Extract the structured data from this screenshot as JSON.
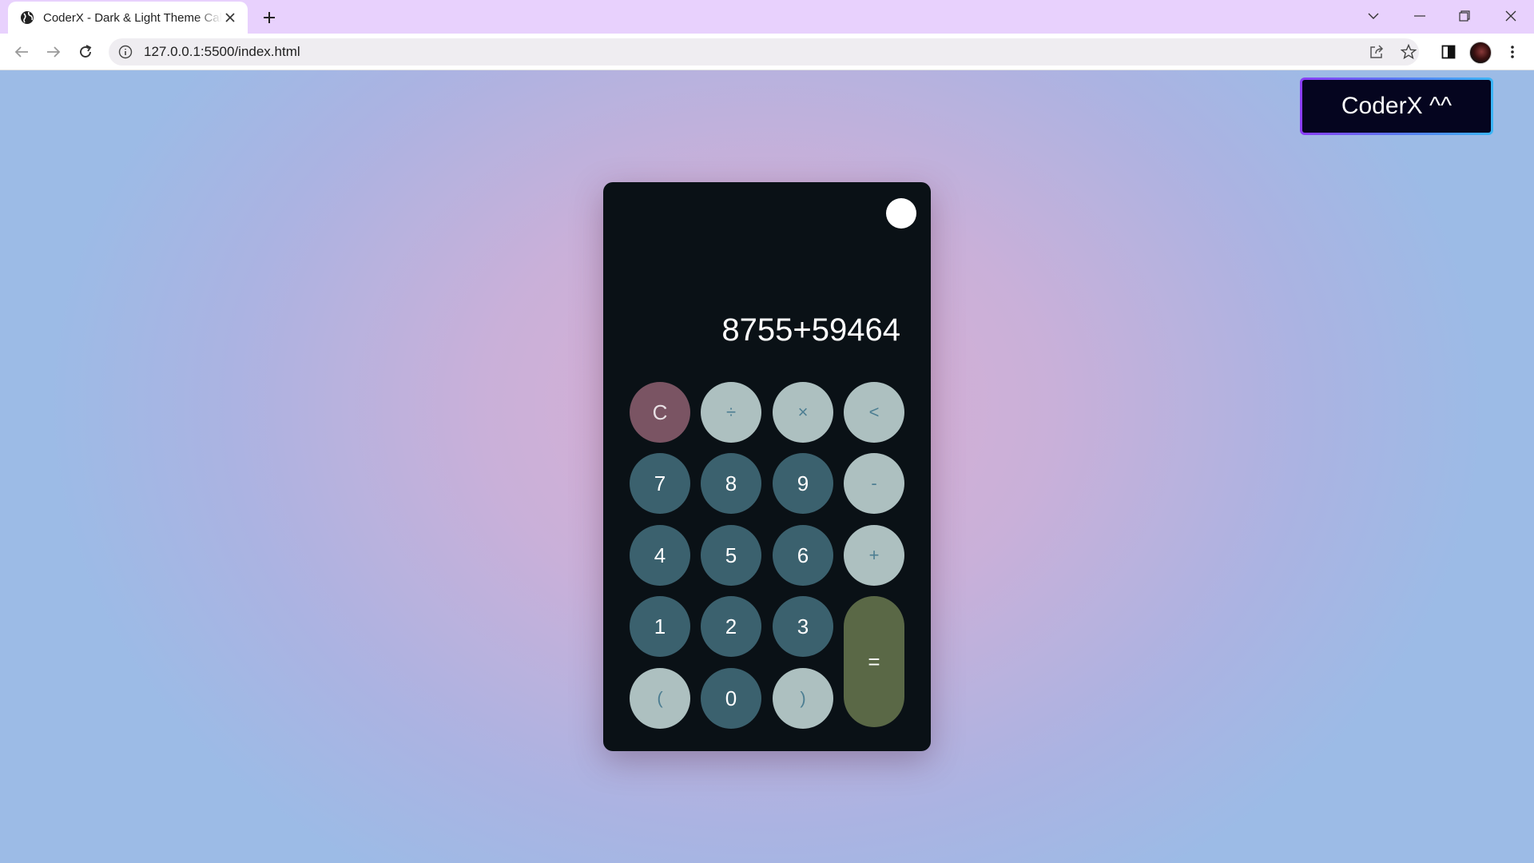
{
  "browser": {
    "tab_title": "CoderX - Dark & Light Theme Calculator",
    "url": "127.0.0.1:5500/index.html",
    "icons": {
      "favicon": "globe-icon",
      "tab_close": "close-icon",
      "new_tab": "plus-icon",
      "back": "back-arrow-icon",
      "forward": "forward-arrow-icon",
      "reload": "reload-icon",
      "site_info": "info-icon",
      "share": "share-icon",
      "bookmark": "star-icon",
      "side_panel": "side-panel-icon",
      "menu": "kebab-menu-icon"
    }
  },
  "page": {
    "brand_button": "CoderX ^^",
    "colors": {
      "calc_bg": "#0a1116",
      "number_key": "#3b616e",
      "operator_key": "#adc0c0",
      "clear_key": "#7a5463",
      "equal_key": "#5a6846"
    }
  },
  "calculator": {
    "display": "8755+59464",
    "keys": {
      "clear": "C",
      "divide": "÷",
      "multiply": "×",
      "backspace": "<",
      "seven": "7",
      "eight": "8",
      "nine": "9",
      "minus": "-",
      "four": "4",
      "five": "5",
      "six": "6",
      "plus": "+",
      "one": "1",
      "two": "2",
      "three": "3",
      "equals": "=",
      "open_paren": "(",
      "zero": "0",
      "close_paren": ")"
    }
  }
}
